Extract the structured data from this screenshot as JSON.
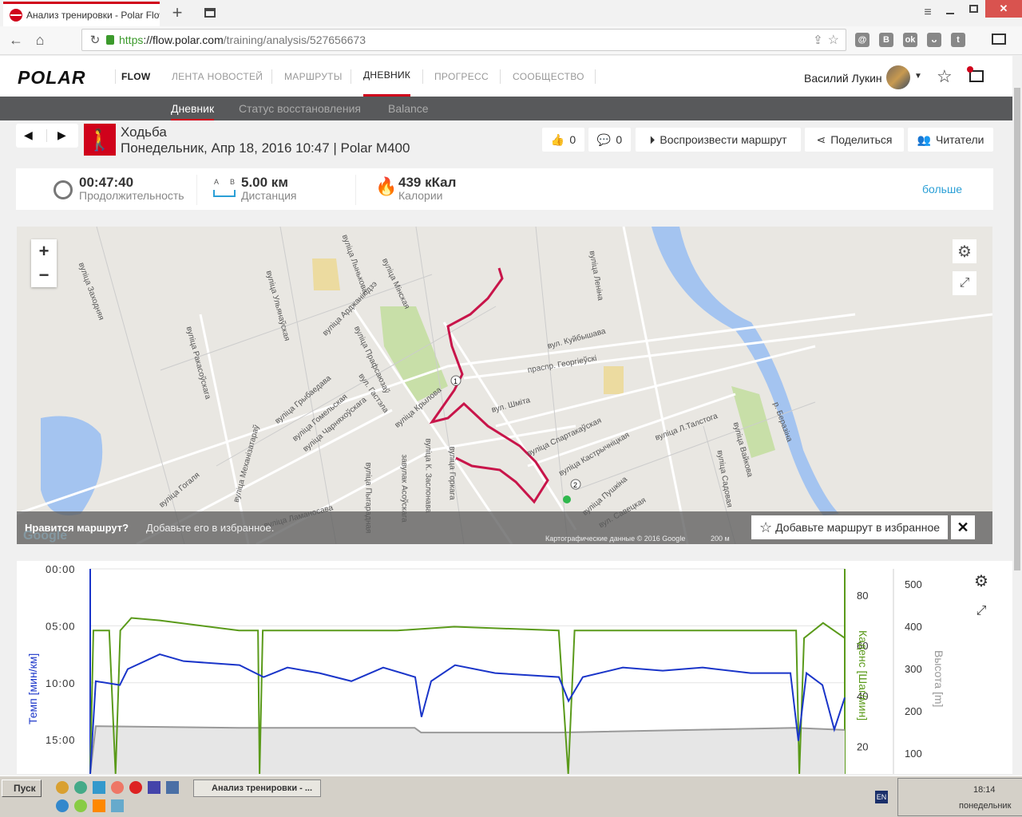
{
  "browser": {
    "tab_title": "Анализ тренировки - Polar Flow",
    "url_scheme": "https",
    "url_host": "://flow.polar.com",
    "url_path": "/training/analysis/527656673"
  },
  "header": {
    "logo": "POLAR",
    "product": "FLOW",
    "nav": [
      "ЛЕНТА НОВОСТЕЙ",
      "МАРШРУТЫ",
      "ДНЕВНИК",
      "ПРОГРЕСС",
      "СООБЩЕСТВО"
    ],
    "active_nav": 2,
    "user_name": "Василий Лукин"
  },
  "subnav": [
    "Дневник",
    "Статус восстановления",
    "Balance"
  ],
  "training": {
    "sport": "Ходьба",
    "subtitle": "Понедельник, Апр 18, 2016 10:47 | Polar M400",
    "likes": "0",
    "comments": "0",
    "replay": "Воспроизвести маршрут",
    "share": "Поделиться",
    "readers": "Читатели"
  },
  "stats": {
    "duration": "00:47:40",
    "duration_label": "Продолжительность",
    "distance": "5.00 км",
    "distance_label": "Дистанция",
    "distance_a": "A",
    "distance_b": "B",
    "calories": "439 кКал",
    "calories_label": "Калории",
    "more": "больше"
  },
  "map": {
    "labels": [
      "вуліца Заходняя",
      "вуліца Ракасоўскага",
      "вуліца Ульянаўская",
      "вуліца Лынькова",
      "вуліца Мінская",
      "вуліца Арджанікідзэ",
      "вуліца Прафсаюзаў",
      "вул. Гастэла",
      "вуліца Грыбаедава",
      "вуліца Гомельская",
      "вуліца Чарняхоўскага",
      "вуліца Крылова",
      "вул. Шміта",
      "праспр. Георгіеўскі",
      "вул. Куйбышава",
      "вуліца Леніна",
      "вуліца Спартакаўская",
      "вуліца Кастрычніцкая",
      "вуліца Л.Талстога",
      "вуліца Вайкова",
      "вуліца Садовая",
      "р. Беразіна",
      "вуліца Пушкіна",
      "вул. Савецкая",
      "вуліца Гогаля",
      "вуліца Механізатараў",
      "вуліца Ламаносава",
      "вуліца Пыгарадная",
      "завулак Асоўскага",
      "вуліца К. Заслонава",
      "вуліца Горкага"
    ],
    "banner_bold": "Нравится маршрут?",
    "banner_text": "Добавьте его в избранное.",
    "add_favorite": "Добавьте маршрут в избранное",
    "attribution": "Картографические данные © 2016 Google",
    "scale": "200 м",
    "google": "Google",
    "marker1": "1",
    "marker2": "2"
  },
  "chart_data": {
    "type": "line",
    "x_unit": "minutes",
    "left_axis": {
      "label": "Темп [мин/км]",
      "ticks": [
        "00:00",
        "05:00",
        "10:00",
        "15:00"
      ],
      "ylim": [
        0,
        18
      ],
      "inverted": true
    },
    "right_axis1": {
      "label": "Каденс [Шаг/мин]",
      "ticks": [
        "80",
        "60",
        "40",
        "20"
      ],
      "ylim": [
        9,
        90.5
      ]
    },
    "right_axis2": {
      "label": "Высота [m]",
      "ticks": [
        "500",
        "400",
        "300",
        "200",
        "100"
      ],
      "ylim": [
        51,
        536
      ]
    },
    "series": [
      {
        "name": "Темп",
        "color": "#1a35c9",
        "axis": "left",
        "points": [
          [
            0,
            18
          ],
          [
            0.35,
            9.86
          ],
          [
            1.87,
            10.2
          ],
          [
            2.37,
            8.8
          ],
          [
            4.39,
            7.5
          ],
          [
            5.9,
            8.1
          ],
          [
            9.43,
            8.45
          ],
          [
            10.95,
            9.5
          ],
          [
            12.46,
            8.66
          ],
          [
            14.48,
            9.15
          ],
          [
            16.5,
            9.86
          ],
          [
            18.51,
            8.66
          ],
          [
            20.53,
            9.5
          ],
          [
            20.93,
            13
          ],
          [
            21.54,
            9.86
          ],
          [
            23.05,
            8.45
          ],
          [
            25.58,
            9.15
          ],
          [
            29.61,
            9.5
          ],
          [
            30.22,
            11.6
          ],
          [
            31.12,
            9.5
          ],
          [
            33.65,
            8.66
          ],
          [
            36.17,
            8.94
          ],
          [
            38.69,
            8.66
          ],
          [
            41.72,
            9.15
          ],
          [
            44.24,
            9.15
          ],
          [
            44.74,
            15.1
          ],
          [
            45.25,
            9.15
          ],
          [
            46.26,
            10.2
          ],
          [
            47.01,
            14.1
          ],
          [
            47.67,
            11.3
          ]
        ]
      },
      {
        "name": "Каденс",
        "color": "#5a9a1a",
        "axis": "right1",
        "points": [
          [
            0,
            9
          ],
          [
            0.2,
            66
          ],
          [
            1.2,
            66
          ],
          [
            1.6,
            9
          ],
          [
            1.9,
            66
          ],
          [
            2.6,
            71
          ],
          [
            4.4,
            70
          ],
          [
            9.4,
            66
          ],
          [
            10.6,
            66
          ],
          [
            10.7,
            9
          ],
          [
            10.9,
            66
          ],
          [
            19.4,
            66
          ],
          [
            23,
            67.5
          ],
          [
            29.6,
            66
          ],
          [
            30.2,
            9
          ],
          [
            30.6,
            66
          ],
          [
            39.6,
            66
          ],
          [
            44.6,
            66
          ],
          [
            44.8,
            9
          ],
          [
            45.1,
            63
          ],
          [
            46.3,
            69
          ],
          [
            47.67,
            63
          ]
        ]
      },
      {
        "name": "Высота",
        "color": "#999999",
        "axis": "right2",
        "points": [
          [
            0,
            51
          ],
          [
            0.35,
            164
          ],
          [
            9.4,
            160
          ],
          [
            20.5,
            160
          ],
          [
            20.9,
            149
          ],
          [
            29.6,
            149
          ],
          [
            44.5,
            160
          ],
          [
            47.67,
            155
          ]
        ]
      }
    ]
  },
  "taskbar": {
    "start": "Пуск",
    "window": "Анализ тренировки - ...",
    "lang": "EN",
    "time": "18:14",
    "day": "понедельник"
  }
}
